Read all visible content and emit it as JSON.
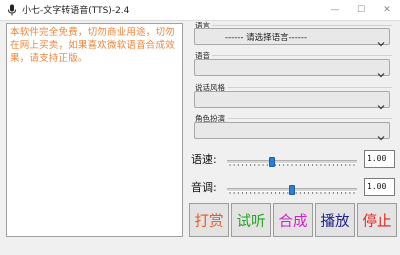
{
  "window": {
    "title": "小七-文字转语音(TTS)-2.4",
    "minimize_icon": "—",
    "maximize_icon": "☐",
    "close_icon": "✕"
  },
  "textarea": {
    "content": "本软件完全免费，切勿商业用途，切勿在网上买卖，如果喜欢微软语音合成效果，请支持正版。"
  },
  "groups": {
    "language": {
      "label": "语言",
      "selected": "------ 请选择语言------"
    },
    "voice": {
      "label": "语音",
      "selected": ""
    },
    "style": {
      "label": "说话风格",
      "selected": ""
    },
    "role": {
      "label": "角色扮演",
      "selected": ""
    }
  },
  "sliders": {
    "speed": {
      "label": "语速:",
      "value": "1.00",
      "position": 0.34
    },
    "pitch": {
      "label": "音调:",
      "value": "1.00",
      "position": 0.5
    }
  },
  "buttons": {
    "reward": {
      "label": "打赏",
      "color": "#e05a2a"
    },
    "preview": {
      "label": "试听",
      "color": "#2aa02a"
    },
    "synthesize": {
      "label": "合成",
      "color": "#d020c8"
    },
    "play": {
      "label": "播放",
      "color": "#20208a"
    },
    "stop": {
      "label": "停止",
      "color": "#e02020"
    }
  }
}
